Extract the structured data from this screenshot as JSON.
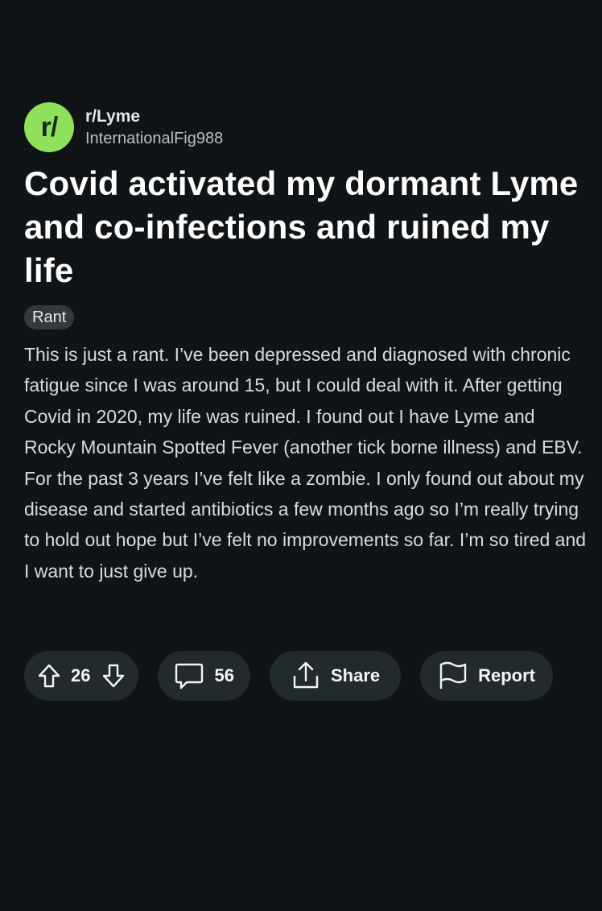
{
  "post": {
    "subreddit": "r/Lyme",
    "author": "InternationalFig988",
    "avatar_text": "r/",
    "title": "Covid activated my dormant Lyme and co-infections and ruined my life",
    "flair": "Rant",
    "body": "This is just a rant. I’ve been depressed and diagnosed with chronic fatigue since I was around 15, but I could deal with it. After getting Covid in 2020, my life was ruined. I found out I have Lyme and Rocky Mountain Spotted Fever (another tick borne illness) and EBV. For the past 3 years I’ve felt like a zombie. I only found out about my disease and started antibiotics a few months ago so I’m really trying to hold out hope but I’ve felt no improvements so far. I’m so tired and I want to just give up."
  },
  "actions": {
    "vote_count": "26",
    "comment_count": "56",
    "share_label": "Share",
    "report_label": "Report"
  },
  "icons": {
    "upvote": "upvote-arrow-icon",
    "downvote": "downvote-arrow-icon",
    "comment": "comment-bubble-icon",
    "share": "share-icon",
    "report": "flag-icon"
  },
  "colors": {
    "background": "#101416",
    "avatar": "#8fe05a",
    "pill": "#222a2d",
    "flair": "#33393c"
  }
}
